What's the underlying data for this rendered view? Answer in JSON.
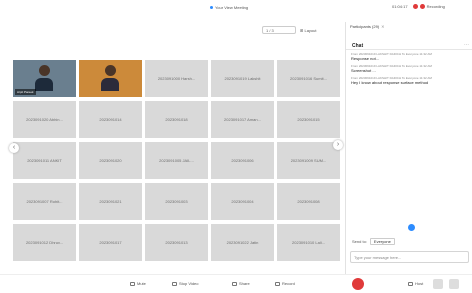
{
  "topbar": {
    "view_label": "Your View Meeting",
    "recording": {
      "time": "01:04:17",
      "label": "Recording"
    },
    "colors": {
      "rec1": "#e03a3a",
      "rec2": "#e03a3a",
      "accent": "#2d8cff"
    }
  },
  "gallery": {
    "pager": "1 / 3",
    "layout_label": "Layout",
    "tiles": [
      {
        "name": "Arpit Pareek",
        "video": true
      },
      {
        "name": "",
        "video": true
      },
      {
        "name": "2023091000 Harsh...",
        "video": false
      },
      {
        "name": "2023091019 Lakshit",
        "video": false
      },
      {
        "name": "2023091016 Sumit...",
        "video": false
      },
      {
        "name": "2023091020 Abhin...",
        "video": false
      },
      {
        "name": "2023091014",
        "video": false
      },
      {
        "name": "2023091018",
        "video": false
      },
      {
        "name": "2023091017 Aman...",
        "video": false
      },
      {
        "name": "2023091015",
        "video": false
      },
      {
        "name": "2023091011 ANKIT",
        "video": false
      },
      {
        "name": "2023091020",
        "video": false
      },
      {
        "name": "2023091005 JAIL...",
        "video": false
      },
      {
        "name": "2023091006",
        "video": false
      },
      {
        "name": "2023091009 SUM...",
        "video": false
      },
      {
        "name": "2023091007 Rohit...",
        "video": false
      },
      {
        "name": "2023091021",
        "video": false
      },
      {
        "name": "2023091003",
        "video": false
      },
      {
        "name": "2023091004",
        "video": false
      },
      {
        "name": "2023091008",
        "video": false
      },
      {
        "name": "2023091012 Dhruv...",
        "video": false
      },
      {
        "name": "2023091017",
        "video": false
      },
      {
        "name": "2023091013",
        "video": false
      },
      {
        "name": "2023091022 Jatin",
        "video": false
      },
      {
        "name": "2023091010 Lali...",
        "video": false
      }
    ]
  },
  "chat": {
    "tab_label": "Participants (29)",
    "title": "Chat",
    "messages": [
      {
        "meta": "From 2023091019 LAKSHIT DADICH To Everyone 11:32 AM",
        "text": "Response not..."
      },
      {
        "meta": "From 2023091019 LAKSHIT DADICH To Everyone 11:32 AM",
        "text": "Screenshot ..."
      },
      {
        "meta": "From 2023091019 LAKSHIT DADICH To Everyone 11:32 AM",
        "text": "Hey I know about response surface method"
      }
    ],
    "to_label": "Send to:",
    "to_value": "Everyone",
    "input_placeholder": "Type your message here..."
  },
  "toolbar": {
    "mute": "Mute",
    "stop_video": "Stop Video",
    "share": "Share",
    "record": "Record",
    "host": "Host"
  }
}
